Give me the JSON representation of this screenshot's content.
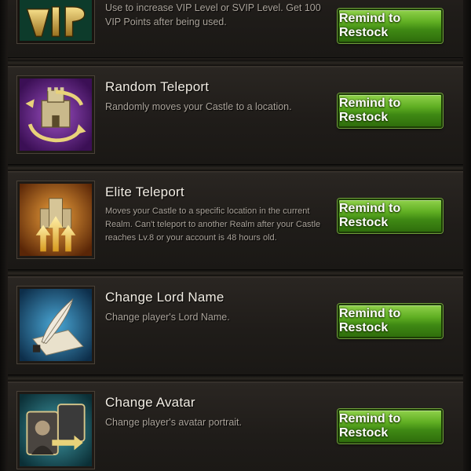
{
  "items": [
    {
      "title": "",
      "description": "Use to increase VIP Level or SVIP Level. Get 100 VIP Points after being used.",
      "button_label": "Remind to Restock",
      "icon": "vip-icon"
    },
    {
      "title": "Random Teleport",
      "description": "Randomly moves your Castle to a location.",
      "button_label": "Remind to Restock",
      "icon": "random-teleport-icon"
    },
    {
      "title": "Elite Teleport",
      "description": "Moves your Castle to a specific location in the current Realm. Can't teleport to another Realm after your Castle reaches Lv.8 or your account is 48 hours old.",
      "button_label": "Remind to Restock",
      "icon": "elite-teleport-icon"
    },
    {
      "title": "Change Lord Name",
      "description": "Change player's Lord Name.",
      "button_label": "Remind to Restock",
      "icon": "quill-icon"
    },
    {
      "title": "Change Avatar",
      "description": "Change player's avatar portrait.",
      "button_label": "Remind to Restock",
      "icon": "avatar-swap-icon"
    }
  ],
  "colors": {
    "button_green": "#5fae22",
    "title_text": "#f2ede4",
    "desc_text": "#aaa39a"
  }
}
